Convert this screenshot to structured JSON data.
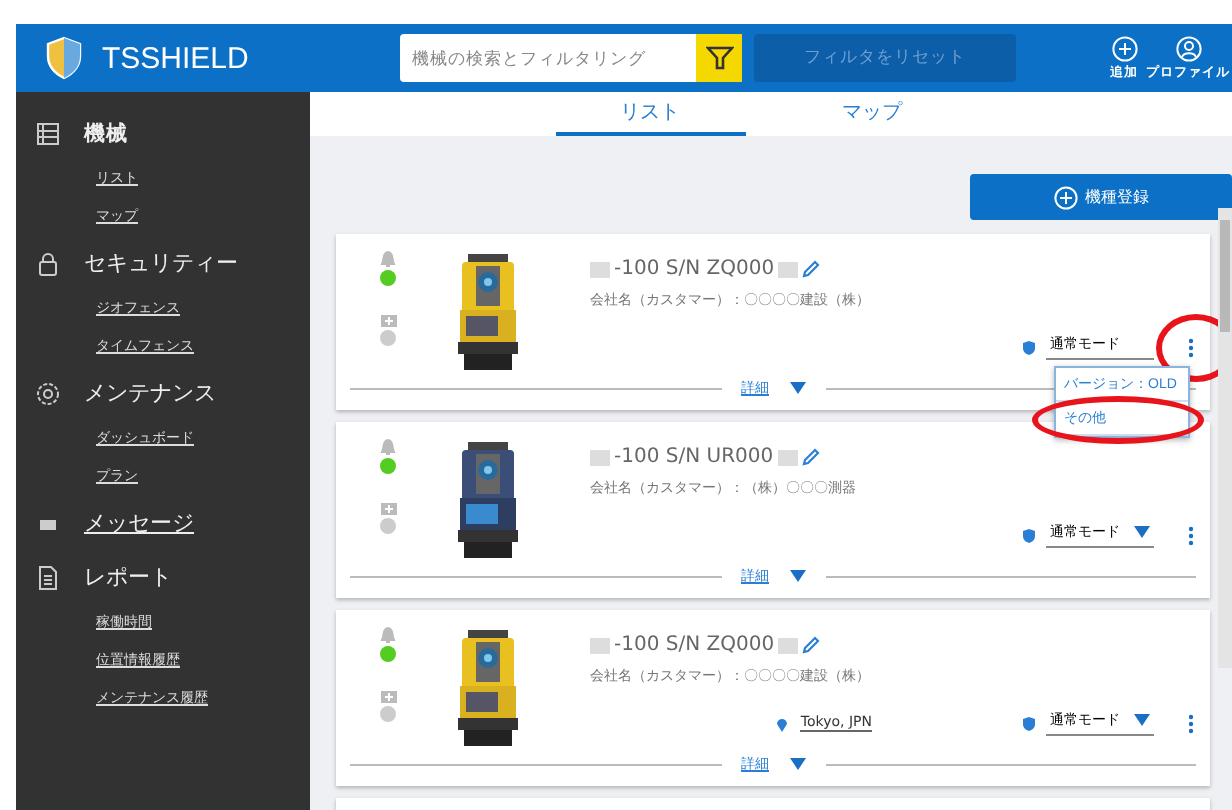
{
  "header": {
    "brand": "TSSHIELD",
    "search": {
      "placeholder": "機械の検索とフィルタリング"
    },
    "reset_button": {
      "label": "フィルタをリセット",
      "disabled": true
    },
    "actions": [
      {
        "kind": "add",
        "label": "追加"
      },
      {
        "kind": "profile",
        "label": "プロファイル"
      }
    ]
  },
  "sidebar": {
    "sections": [
      {
        "kind": "machine",
        "label": "機械",
        "underlined": false,
        "children": [
          {
            "label": "リスト"
          },
          {
            "label": "マップ"
          }
        ]
      },
      {
        "kind": "lock",
        "label": "セキュリティー",
        "underlined": false,
        "children": [
          {
            "label": "ジオフェンス"
          },
          {
            "label": "タイムフェンス"
          }
        ]
      },
      {
        "kind": "gear",
        "label": "メンテナンス",
        "underlined": false,
        "children": [
          {
            "label": "ダッシュボード"
          },
          {
            "label": "プラン"
          }
        ]
      },
      {
        "kind": "message",
        "label": "メッセージ",
        "underlined": true
      },
      {
        "kind": "report",
        "label": "レポート",
        "underlined": false,
        "children": [
          {
            "label": "稼働時間"
          },
          {
            "label": "位置情報履歴"
          },
          {
            "label": "メンテナンス履歴"
          }
        ]
      }
    ]
  },
  "tabs": [
    {
      "label": "リスト",
      "selected": true
    },
    {
      "label": "マップ",
      "selected": false
    }
  ],
  "register_button": {
    "label": "機種登録"
  },
  "machines": [
    {
      "title": "-100 S/N ZQ000",
      "company": "会社名（カスタマー）：〇〇〇〇建設（株）",
      "status_dots": [
        {
          "kind": "alarm",
          "color": "#55cc22"
        },
        {
          "kind": "maintenance",
          "color": "#cccccc"
        }
      ],
      "mode": "通常モード",
      "mode_caret": false,
      "kebab_circled": true,
      "menu": [
        {
          "label": "バージョン：OLD",
          "circled": false
        },
        {
          "label": "その他",
          "circled": true
        }
      ],
      "details": "詳細"
    },
    {
      "title": "-100 S/N UR000",
      "company": "会社名（カスタマー）：（株）〇〇〇測器",
      "status_dots": [
        {
          "kind": "alarm",
          "color": "#55cc22"
        },
        {
          "kind": "maintenance",
          "color": "#cccccc"
        }
      ],
      "mode": "通常モード",
      "mode_caret": true,
      "kebab_circled": false,
      "details": "詳細"
    },
    {
      "title": "-100 S/N ZQ000",
      "company": "会社名（カスタマー）：〇〇〇〇建設（株）",
      "status_dots": [
        {
          "kind": "alarm",
          "color": "#55cc22"
        },
        {
          "kind": "maintenance",
          "color": "#cccccc"
        }
      ],
      "location": "Tokyo, JPN",
      "mode": "通常モード",
      "mode_caret": true,
      "kebab_circled": false,
      "details": "詳細"
    }
  ]
}
